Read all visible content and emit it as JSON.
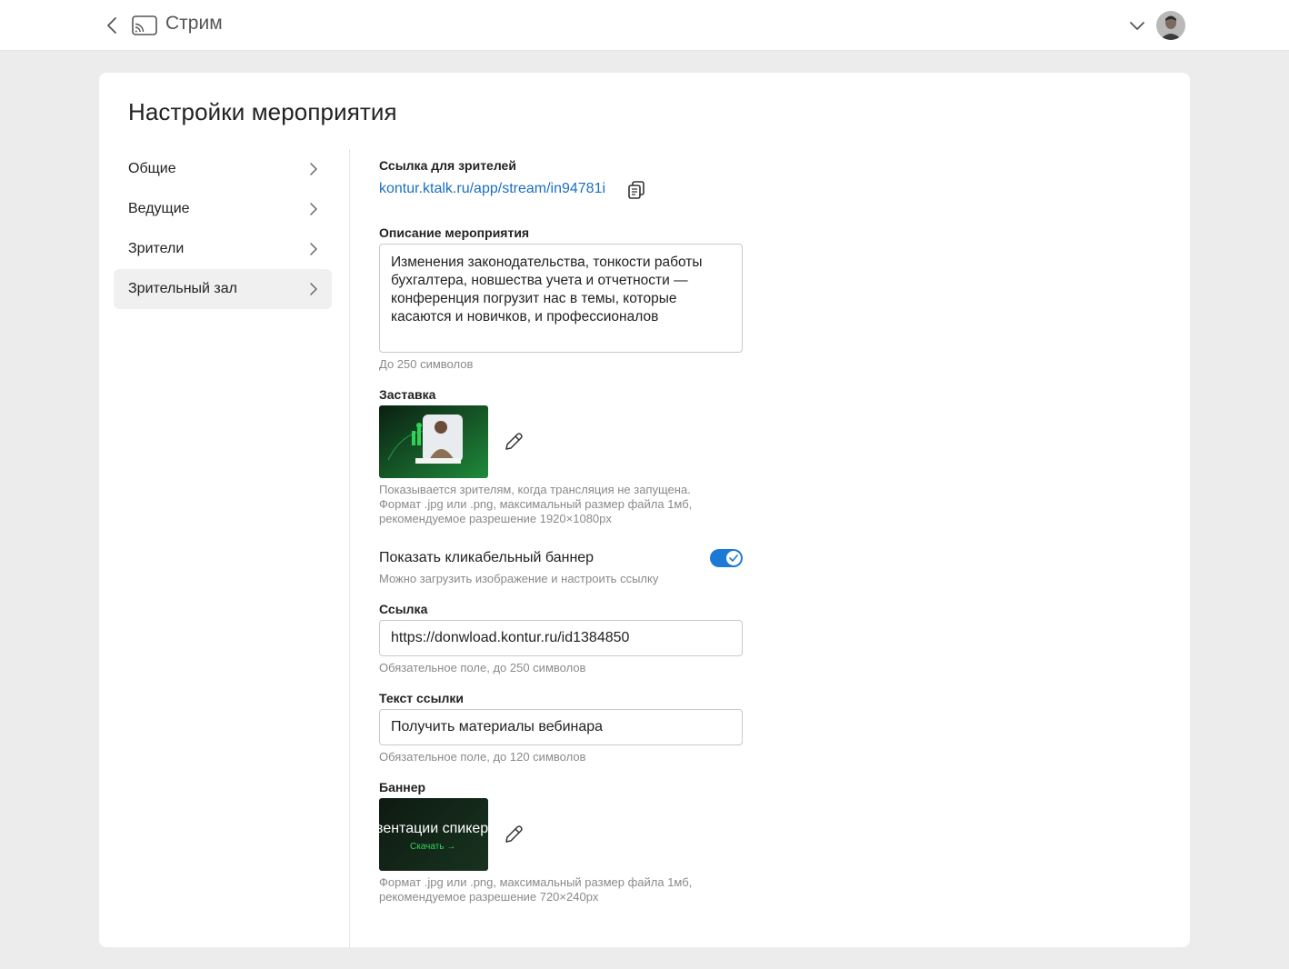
{
  "header": {
    "app_title": "Стрим",
    "back_icon": "chevron-left-icon",
    "app_icon": "cast-icon",
    "dropdown_icon": "chevron-down-icon"
  },
  "page": {
    "title": "Настройки мероприятия"
  },
  "sidebar": {
    "items": [
      {
        "label": "Общие",
        "active": false
      },
      {
        "label": "Ведущие",
        "active": false
      },
      {
        "label": "Зрители",
        "active": false
      },
      {
        "label": "Зрительный зал",
        "active": true
      }
    ]
  },
  "viewer_link": {
    "label": "Ссылка для зрителей",
    "url": "kontur.ktalk.ru/app/stream/in94781i",
    "copy_icon": "copy-icon"
  },
  "description": {
    "label": "Описание мероприятия",
    "value": "Изменения законодательства, тонкости работы бухгалтера, новшества учета и отчетности — конференция погрузит нас в темы, которые касаются и новичков, и профессионалов",
    "hint": "До 250 символов"
  },
  "cover": {
    "label": "Заставка",
    "hint_line1": "Показывается зрителям, когда трансляция не запущена.",
    "hint_line2": "Формат .jpg или .png, максимальный размер файла 1мб,",
    "hint_line3": "рекомендуемое разрешение 1920×1080px"
  },
  "banner_toggle": {
    "label": "Показать кликабельный баннер",
    "hint": "Можно загрузить изображение и настроить ссылку",
    "enabled": true
  },
  "link_field": {
    "label": "Ссылка",
    "value": "https://donwload.kontur.ru/id1384850",
    "hint": "Обязательное поле, до 250 символов"
  },
  "link_text_field": {
    "label": "Текст ссылки",
    "value": "Получить материалы вебинара",
    "hint": "Обязательное поле, до 120 символов"
  },
  "banner": {
    "label": "Баннер",
    "image_text": "вентации спикер",
    "image_cta": "Скачать →",
    "hint_line1": "Формат .jpg или .png, максимальный размер файла 1мб,",
    "hint_line2": "рекомендуемое разрешение 720×240px"
  },
  "colors": {
    "accent": "#1c7ad6",
    "link": "#1c6fc1",
    "cover_green": "#1f8a3a",
    "banner_green": "#2fd35a"
  }
}
